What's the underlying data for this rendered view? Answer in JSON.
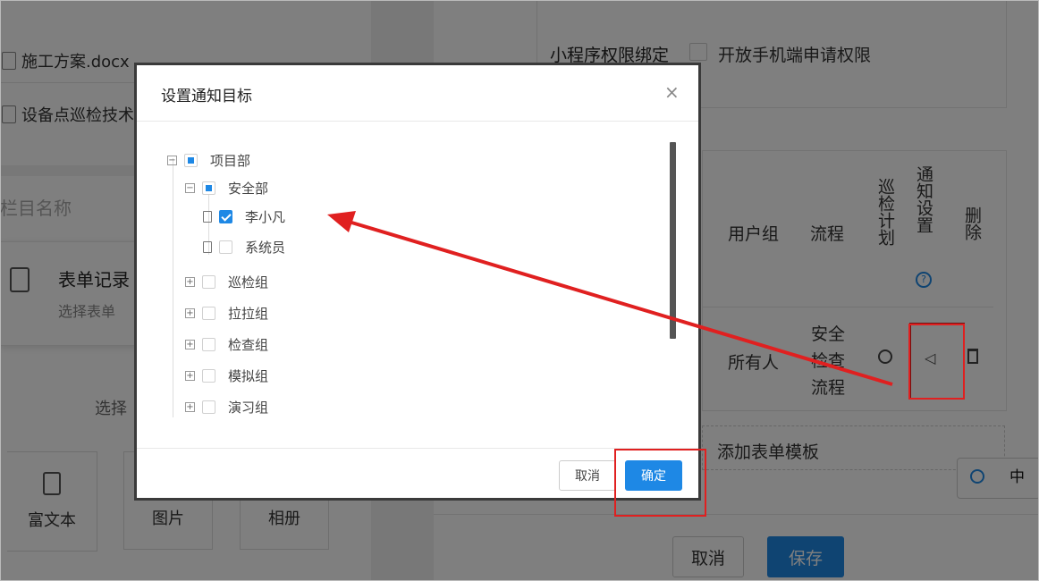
{
  "background": {
    "files": [
      "施工方案.docx",
      "设备点巡检技术"
    ],
    "column_name_label": "栏目名称",
    "form_card": {
      "title": "表单记录",
      "subtitle": "选择表单"
    },
    "choose_label": "选择",
    "tiles": [
      "富文本",
      "图片",
      "相册"
    ],
    "binding_label": "小程序权限绑定",
    "open_mobile_label": "开放手机端申请权限",
    "table": {
      "headers": [
        "用户组",
        "流程",
        "巡检计划",
        "通知设置",
        "删除"
      ],
      "row": {
        "user_group": "所有人",
        "process": "安全检查流程"
      }
    },
    "add_template_label": "添加表单模板",
    "lang_badge": "中",
    "cancel_label": "取消",
    "save_label": "保存",
    "colors": {
      "primary": "#1e88e5",
      "highlight": "#e02020"
    }
  },
  "dialog": {
    "title": "设置通知目标",
    "close_glyph": "×",
    "tree": [
      {
        "label": "项目部",
        "state": "partial",
        "expanded": true
      },
      {
        "label": "安全部",
        "state": "partial",
        "expanded": true
      },
      {
        "label": "李小凡",
        "state": "checked",
        "leaf": true
      },
      {
        "label": "系统员",
        "state": "unchecked",
        "leaf": true
      },
      {
        "label": "巡检组",
        "state": "unchecked",
        "expanded": false
      },
      {
        "label": "拉拉组",
        "state": "unchecked",
        "expanded": false
      },
      {
        "label": "检查组",
        "state": "unchecked",
        "expanded": false
      },
      {
        "label": "模拟组",
        "state": "unchecked",
        "expanded": false
      },
      {
        "label": "演习组",
        "state": "unchecked",
        "expanded": false
      }
    ],
    "cancel_label": "取消",
    "confirm_label": "确定"
  }
}
